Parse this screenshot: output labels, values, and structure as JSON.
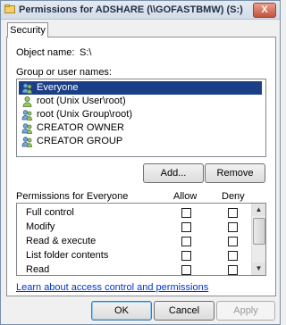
{
  "window": {
    "title": "Permissions for ADSHARE (\\\\GOFASTBMW) (S:)",
    "close_label": "X"
  },
  "tabs": [
    {
      "label": "Security"
    }
  ],
  "object": {
    "label": "Object name:",
    "value": "S:\\"
  },
  "group_label": "Group or user names:",
  "users": [
    {
      "name": "Everyone",
      "selected": true,
      "icon": "users-group-icon"
    },
    {
      "name": "root (Unix User\\root)",
      "selected": false,
      "icon": "user-icon"
    },
    {
      "name": "root (Unix Group\\root)",
      "selected": false,
      "icon": "users-group-icon"
    },
    {
      "name": "CREATOR OWNER",
      "selected": false,
      "icon": "users-group-icon"
    },
    {
      "name": "CREATOR GROUP",
      "selected": false,
      "icon": "users-group-icon"
    }
  ],
  "buttons": {
    "add": "Add...",
    "remove": "Remove",
    "ok": "OK",
    "cancel": "Cancel",
    "apply": "Apply"
  },
  "permissions": {
    "label": "Permissions for Everyone",
    "allow_label": "Allow",
    "deny_label": "Deny",
    "rows": [
      {
        "name": "Full control",
        "allow": false,
        "deny": false
      },
      {
        "name": "Modify",
        "allow": false,
        "deny": false
      },
      {
        "name": "Read & execute",
        "allow": false,
        "deny": false
      },
      {
        "name": "List folder contents",
        "allow": false,
        "deny": false
      },
      {
        "name": "Read",
        "allow": false,
        "deny": false
      }
    ]
  },
  "link_text": "Learn about access control and permissions"
}
